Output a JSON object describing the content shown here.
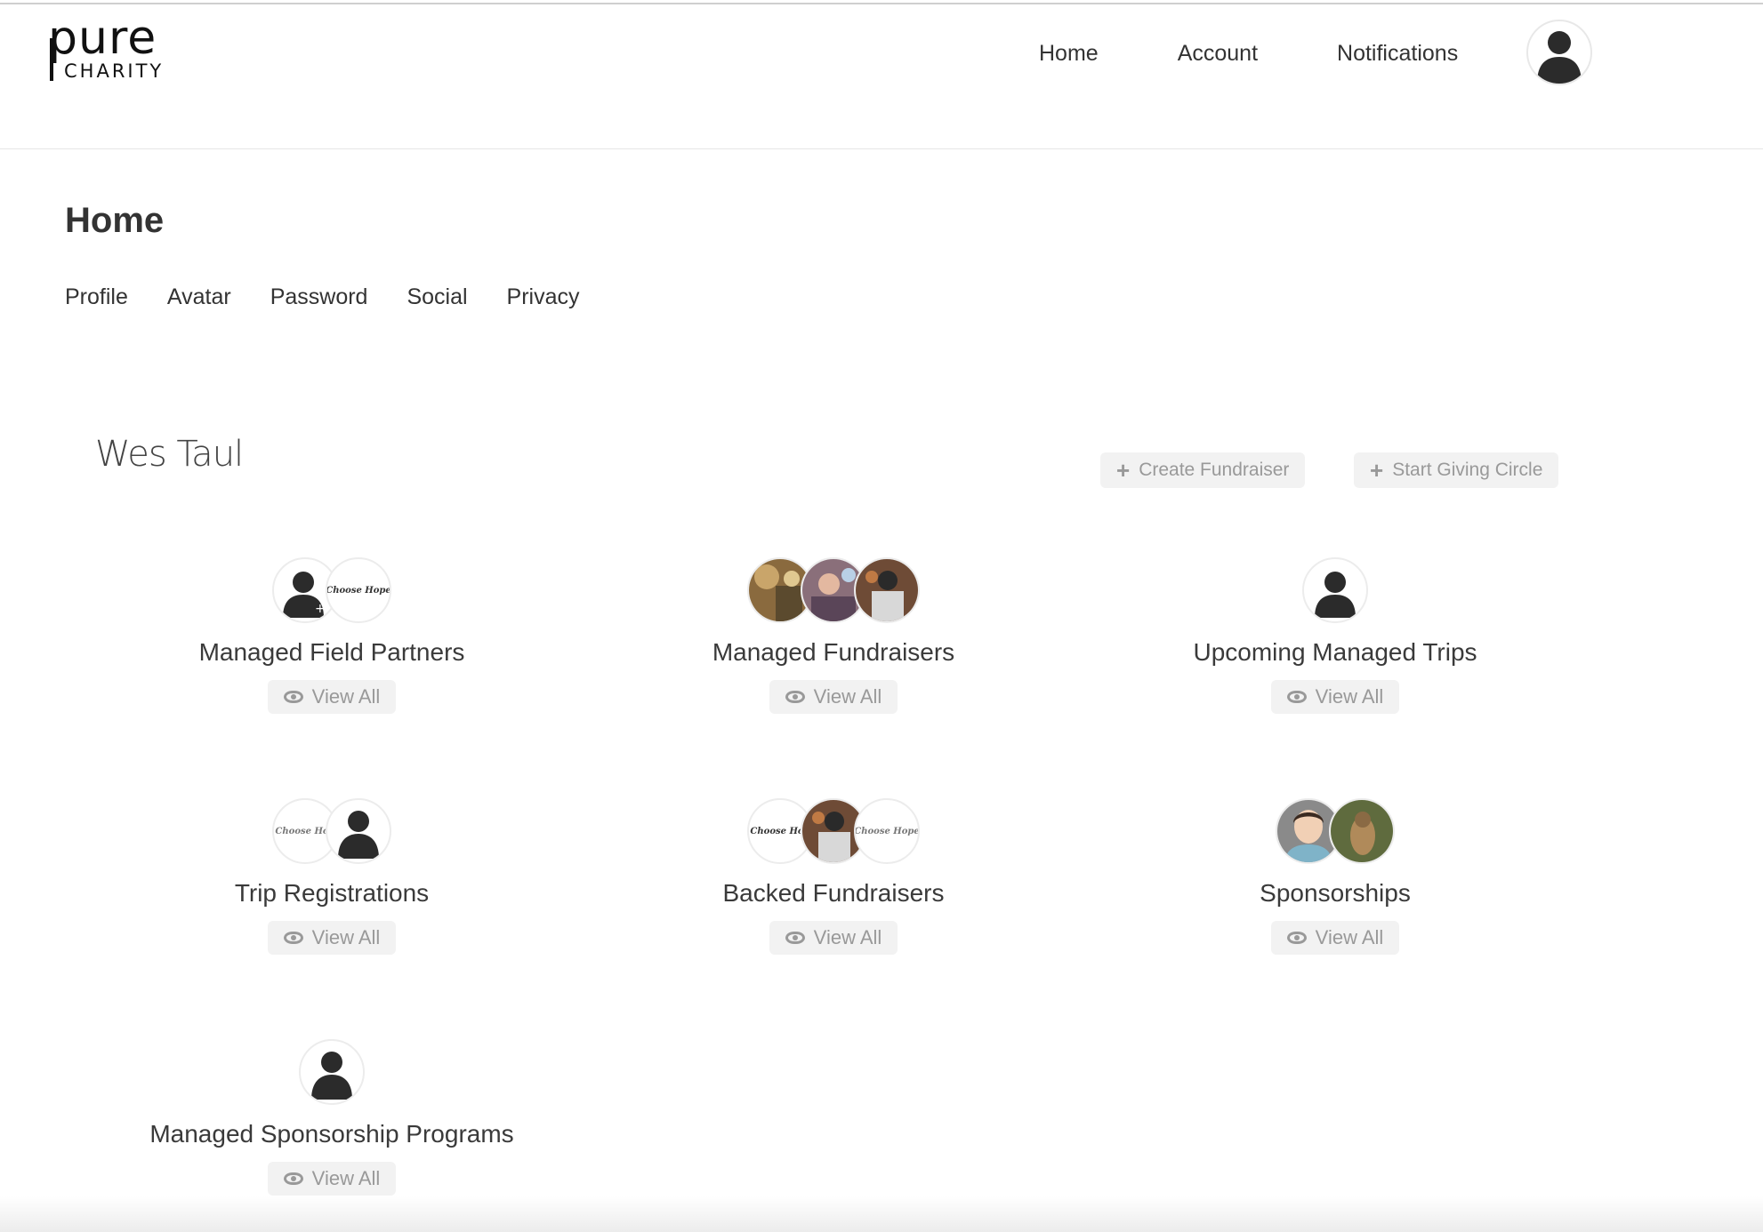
{
  "brand": {
    "logo_word": "pure",
    "logo_sub": "CHARITY"
  },
  "nav": {
    "items": [
      "Home",
      "Account",
      "Notifications"
    ]
  },
  "page": {
    "title": "Home"
  },
  "subnav": {
    "items": [
      "Profile",
      "Avatar",
      "Password",
      "Social",
      "Privacy"
    ]
  },
  "user": {
    "name": "Wes Taul"
  },
  "actions": {
    "create_fundraiser": "Create Fundraiser",
    "start_giving_circle": "Start Giving Circle"
  },
  "avatar_labels": {
    "choose_hope": "Choose Hope",
    "choose_hop": "Choose Hop"
  },
  "tiles": [
    {
      "title": "Managed Field Partners",
      "view_label": "View All"
    },
    {
      "title": "Managed Fundraisers",
      "view_label": "View All"
    },
    {
      "title": "Upcoming Managed Trips",
      "view_label": "View All"
    },
    {
      "title": "Trip Registrations",
      "view_label": "View All"
    },
    {
      "title": "Backed Fundraisers",
      "view_label": "View All"
    },
    {
      "title": "Sponsorships",
      "view_label": "View All"
    },
    {
      "title": "Managed Sponsorship Programs",
      "view_label": "View All"
    }
  ],
  "colors": {
    "button_bg": "#f2f2f2",
    "button_text": "#999999",
    "text": "#333333"
  }
}
